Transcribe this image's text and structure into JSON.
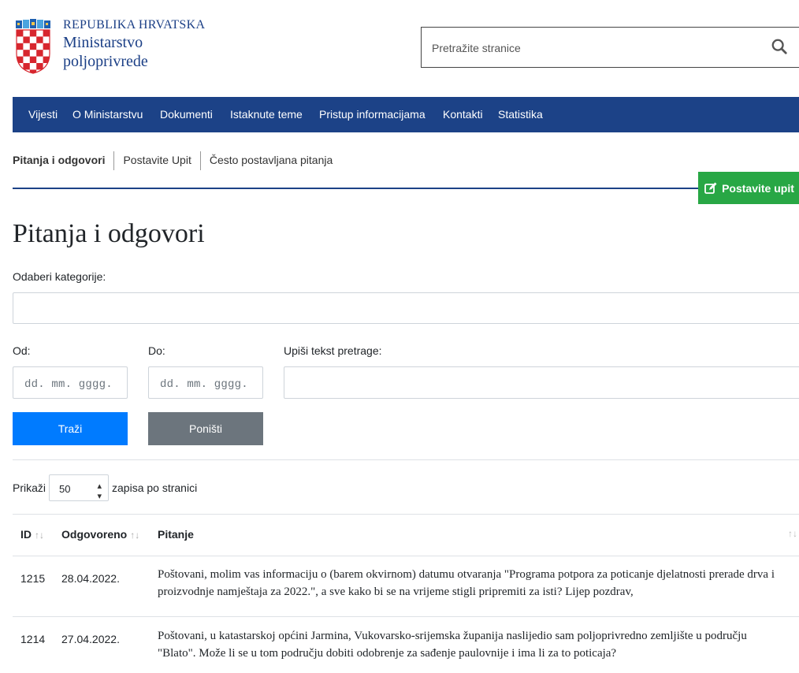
{
  "header": {
    "republic": "REPUBLIKA HRVATSKA",
    "ministry_line1": "Ministarstvo",
    "ministry_line2": "poljoprivrede",
    "search_placeholder": "Pretražite stranice",
    "search_icon": "search-icon"
  },
  "nav": {
    "items": [
      "Vijesti",
      "O Ministarstvu",
      "Dokumenti",
      "Istaknute teme",
      "Pristup informacijama",
      "Kontakti",
      "Statistika"
    ]
  },
  "subnav": {
    "items": [
      "Pitanja i odgovori",
      "Postavite Upit",
      "Često postavljana pitanja"
    ]
  },
  "cta": {
    "label": "Postavite upit",
    "icon": "edit-icon",
    "color": "#28a745"
  },
  "page": {
    "title": "Pitanja i odgovori"
  },
  "filters": {
    "category_label": "Odaberi kategorije:",
    "from_label": "Od:",
    "to_label": "Do:",
    "text_label": "Upiši tekst pretrage:",
    "date_placeholder": "dd. mm. gggg.",
    "search_button": "Traži",
    "reset_button": "Poništi"
  },
  "length": {
    "prefix": "Prikaži",
    "value": "50",
    "suffix": "zapisa po stranici"
  },
  "table": {
    "headers": [
      "ID",
      "Odgovoreno",
      "Pitanje"
    ],
    "rows": [
      {
        "id": "1215",
        "date": "28.04.2022.",
        "question": "Poštovani, molim vas informaciju o (barem okvirnom) datumu otvaranja \"Programa potpora za poticanje djelatnosti prerade drva i proizvodnje namještaja za 2022.\", a sve kako bi se na vrijeme stigli pripremiti za isti? Lijep pozdrav,"
      },
      {
        "id": "1214",
        "date": "27.04.2022.",
        "question": "Poštovani, u katastarskoj općini Jarmina, Vukovarsko-srijemska županija naslijedio sam poljoprivredno zemljište u području \"Blato\". Može li se u tom području dobiti odobrenje za sađenje paulovnije i ima li za to poticaja?"
      }
    ]
  },
  "colors": {
    "brand_blue": "#1c4287",
    "primary": "#007bff",
    "secondary": "#6c757d"
  }
}
